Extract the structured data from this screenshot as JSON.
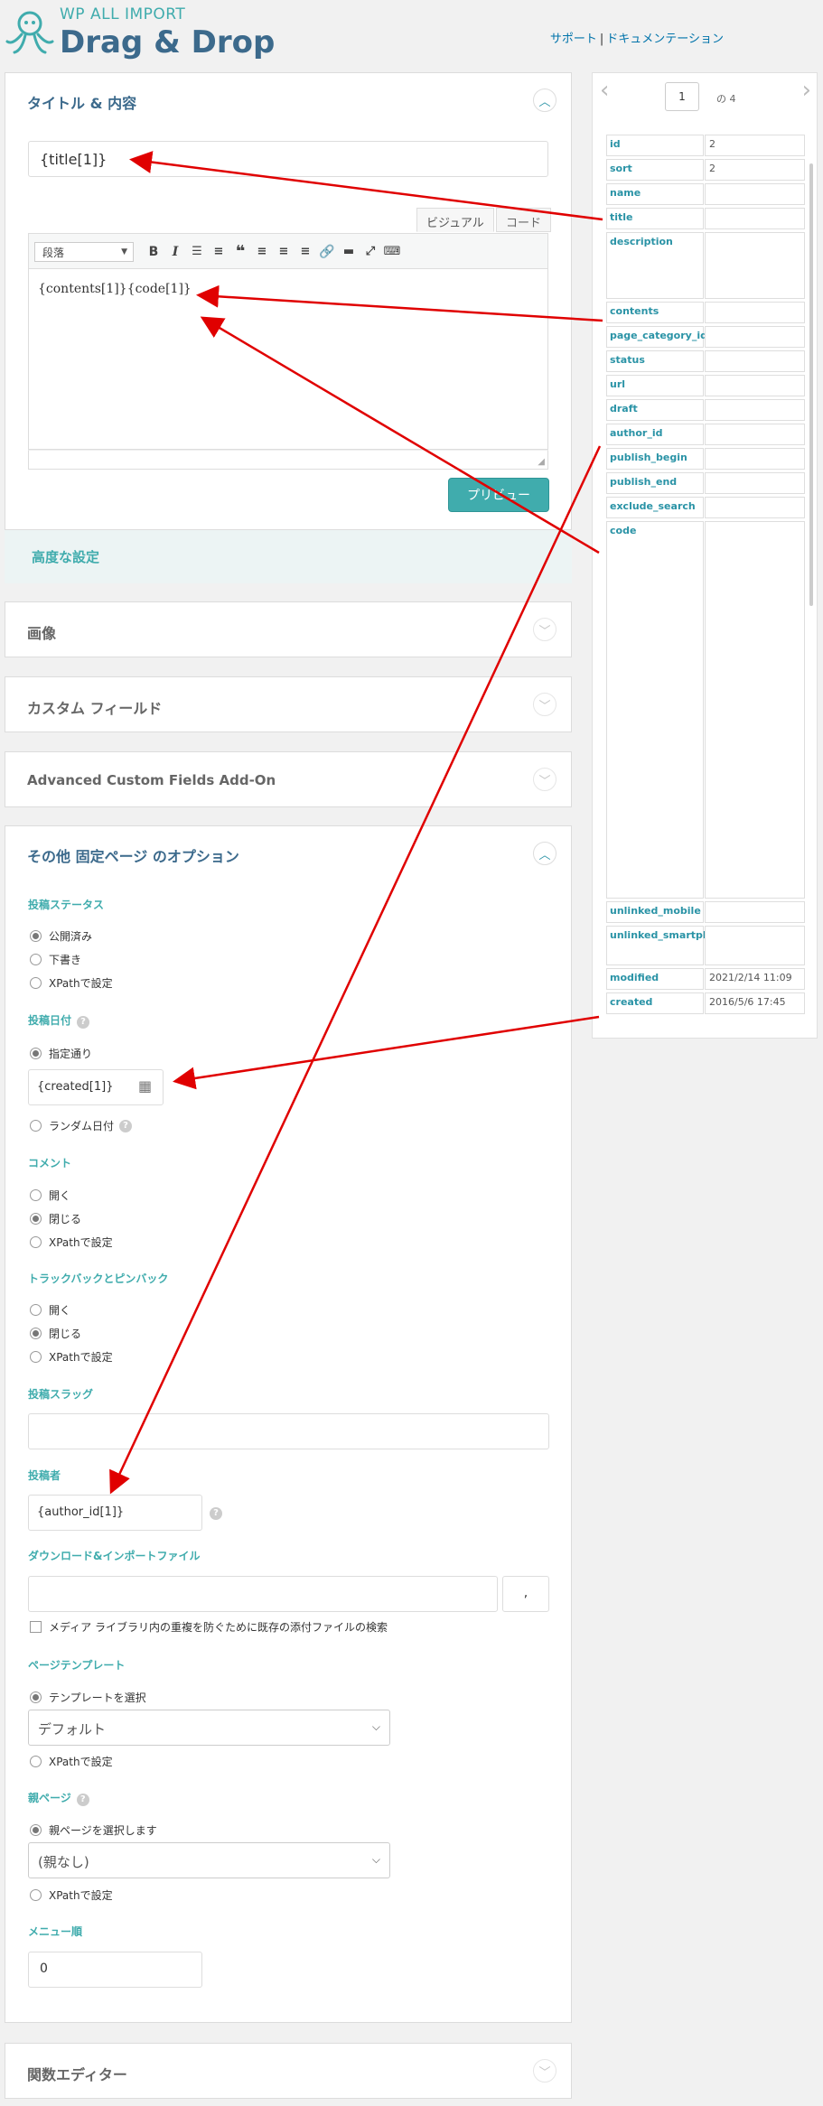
{
  "header": {
    "brand_sub": "WP ALL IMPORT",
    "brand_main": "Drag & Drop",
    "support_link": "サポート",
    "separator": "|",
    "docs_link": "ドキュメンテーション"
  },
  "title_panel": {
    "heading": "タイトル & 内容",
    "title_value": "{title[1]}",
    "tab_visual": "ビジュアル",
    "tab_code": "コード",
    "format_select": "段落",
    "content_value": "{contents[1]}{code[1]}",
    "preview_button": "プリビュー",
    "advanced_settings": "高度な設定"
  },
  "collapsed_panels": {
    "images": "画像",
    "custom_fields": "カスタム フィールド",
    "acf": "Advanced Custom Fields Add-On",
    "function_editor": "関数エディター"
  },
  "options_panel": {
    "heading": "その他 固定ページ のオプション",
    "post_status": {
      "label": "投稿ステータス",
      "options": [
        "公開済み",
        "下書き",
        "XPathで設定"
      ],
      "selected": 0
    },
    "post_date": {
      "label": "投稿日付",
      "specified": "指定通り",
      "value": "{created[1]}",
      "random": "ランダム日付"
    },
    "comments": {
      "label": "コメント",
      "options": [
        "開く",
        "閉じる",
        "XPathで設定"
      ],
      "selected": 1
    },
    "trackbacks": {
      "label": "トラックバックとピンバック",
      "options": [
        "開く",
        "閉じる",
        "XPathで設定"
      ],
      "selected": 1
    },
    "slug": {
      "label": "投稿スラッグ",
      "value": ""
    },
    "author": {
      "label": "投稿者",
      "value": "{author_id[1]}"
    },
    "download": {
      "label": "ダウンロード&インポートファイル",
      "value": "",
      "delimiter": ",",
      "dedupe_checkbox": "メディア ライブラリ内の重複を防ぐために既存の添付ファイルの検索"
    },
    "page_template": {
      "label": "ページテンプレート",
      "choose": "テンプレートを選択",
      "selected_value": "デフォルト",
      "xpath": "XPathで設定"
    },
    "parent_page": {
      "label": "親ページ",
      "choose": "親ページを選択します",
      "selected_value": "(親なし)",
      "xpath": "XPathで設定"
    },
    "menu_order": {
      "label": "メニュー順",
      "value": "0"
    }
  },
  "sidebar": {
    "current_page": "1",
    "of_total": "の 4",
    "rows": [
      {
        "key": "id",
        "value": "2"
      },
      {
        "key": "sort",
        "value": "2"
      },
      {
        "key": "name",
        "value": ""
      },
      {
        "key": "title",
        "value": ""
      },
      {
        "key": "description",
        "value": ""
      },
      {
        "key": "contents",
        "value": ""
      },
      {
        "key": "page_category_id",
        "value": ""
      },
      {
        "key": "status",
        "value": ""
      },
      {
        "key": "url",
        "value": ""
      },
      {
        "key": "draft",
        "value": ""
      },
      {
        "key": "author_id",
        "value": ""
      },
      {
        "key": "publish_begin",
        "value": ""
      },
      {
        "key": "publish_end",
        "value": ""
      },
      {
        "key": "exclude_search",
        "value": ""
      },
      {
        "key": "code",
        "value": ""
      },
      {
        "key": "unlinked_mobile",
        "value": ""
      },
      {
        "key": "unlinked_smartphone",
        "value": ""
      },
      {
        "key": "modified",
        "value": "2021/2/14 11:09"
      },
      {
        "key": "created",
        "value": "2016/5/6 17:45"
      }
    ]
  },
  "colors": {
    "accent_teal": "#40acad",
    "brand_blue": "#3c6a8c",
    "arrow_red": "#e00000"
  }
}
